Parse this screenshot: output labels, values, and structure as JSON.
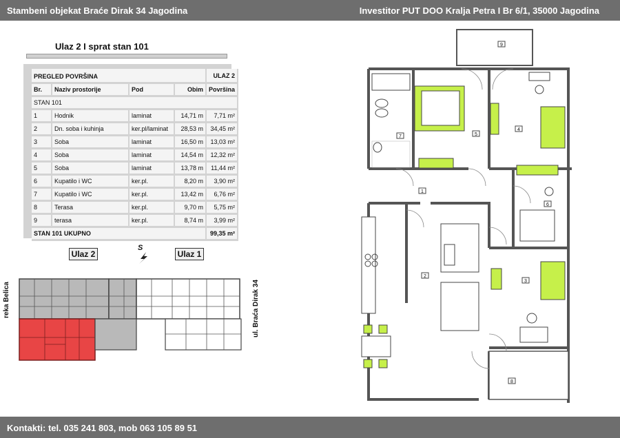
{
  "header": {
    "left": "Stambeni  objekat Braće Dirak 34  Jagodina",
    "right": "Investitor PUT DOO Kralja Petra I Br 6/1, 35000 Jagodina"
  },
  "subtitle": "Ulaz 2 I sprat stan 101",
  "table": {
    "title": "PREGLED POVRŠINA",
    "entrance": "ULAZ 2",
    "columns": [
      "Br.",
      "Naziv prostorije",
      "Pod",
      "Obim",
      "Površina"
    ],
    "section": "STAN 101",
    "rows": [
      [
        "1",
        "Hodnik",
        "laminat",
        "14,71 m",
        "7,71 m²"
      ],
      [
        "2",
        "Dn. soba i kuhinja",
        "ker.pl/laminat",
        "28,53 m",
        "34,45 m²"
      ],
      [
        "3",
        "Soba",
        "laminat",
        "16,50 m",
        "13,03 m²"
      ],
      [
        "4",
        "Soba",
        "laminat",
        "14,54 m",
        "12,32 m²"
      ],
      [
        "5",
        "Soba",
        "laminat",
        "13,78 m",
        "11,44 m²"
      ],
      [
        "6",
        "Kupatilo i WC",
        "ker.pl.",
        "8,20 m",
        "3,90 m²"
      ],
      [
        "7",
        "Kupatilo i WC",
        "ker.pl.",
        "13,42 m",
        "6,76 m²"
      ],
      [
        "8",
        "Terasa",
        "ker.pl.",
        "9,70 m",
        "5,75 m²"
      ],
      [
        "9",
        "terasa",
        "ker.pl.",
        "8,74 m",
        "3,99 m²"
      ]
    ],
    "total_label": "STAN 101  UKUPNO",
    "total_value": "99,35 m²"
  },
  "site": {
    "entrance2": "Ulaz 2",
    "entrance1": "Ulaz 1",
    "north": "S",
    "river": "reka Belica",
    "street": "ul. Braća Dirak 34"
  },
  "room_numbers": [
    "1",
    "2",
    "3",
    "4",
    "5",
    "6",
    "7",
    "8",
    "9"
  ],
  "footer": "Kontakti: tel. 035 241 803, mob 063 105 89 51",
  "colors": {
    "bar": "#6e6e6e",
    "highlight": "#e84545",
    "furniture": "#c6f04a",
    "wall": "#555555"
  }
}
